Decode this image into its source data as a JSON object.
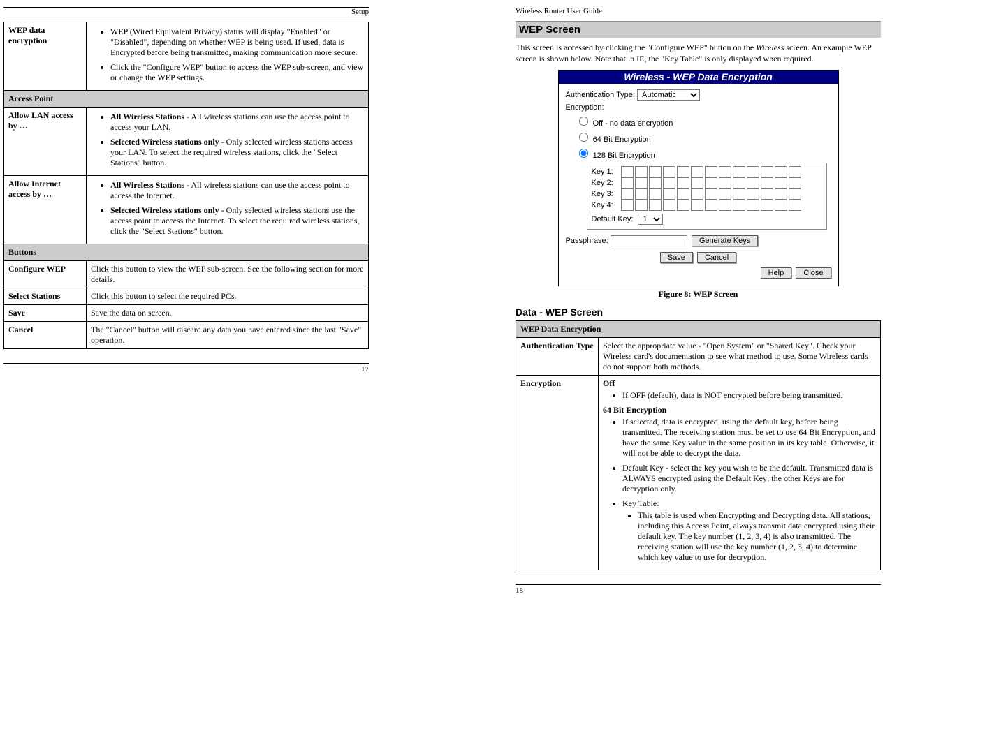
{
  "left": {
    "header": "Setup",
    "pagenum": "17",
    "row_wep_label": "WEP data encryption",
    "row_wep_b1": "WEP (Wired Equivalent Privacy) status will display \"Enabled\" or \"Disabled\", depending on whether WEP is being used. If used, data is Encrypted before being transmitted, making communication more secure.",
    "row_wep_b2": "Click the \"Configure WEP\" button to access the WEP sub-screen, and view or change the WEP settings.",
    "sec_ap": "Access Point",
    "row_lan_label": "Allow LAN access by …",
    "row_lan_b1_bold": "All Wireless Stations ",
    "row_lan_b1_rest": " - All wireless stations can use the access point to access your LAN.",
    "row_lan_b2_bold": "Selected Wireless stations only",
    "row_lan_b2_rest": " - Only selected wireless stations access your LAN. To select the required wireless stations, click the \"Select Stations\" button.",
    "row_int_label": "Allow Internet access by …",
    "row_int_b1_bold": "All Wireless Stations ",
    "row_int_b1_rest": " - All wireless stations can use the access point to access the Internet.",
    "row_int_b2_bold": "Selected Wireless stations only",
    "row_int_b2_rest": " - Only selected wireless stations use the access point to access the Internet. To select the required wireless stations, click the \"Select Stations\" button.",
    "sec_buttons": "Buttons",
    "btn_cfg_label": "Configure WEP",
    "btn_cfg_text": "Click this button to view the WEP sub-screen. See the following section for more details.",
    "btn_sel_label": "Select Stations",
    "btn_sel_text": "Click this button to select the required PCs.",
    "btn_save_label": "Save",
    "btn_save_text": "Save the data on screen.",
    "btn_cancel_label": "Cancel",
    "btn_cancel_text": "The \"Cancel\" button will discard any data you have entered since the last \"Save\" operation."
  },
  "right": {
    "header": "Wireless Router User Guide",
    "pagenum": "18",
    "title": "WEP Screen",
    "intro_1": "This screen is accessed by clicking the \"Configure WEP\" button on the ",
    "intro_em": "Wireless",
    "intro_2": " screen. An example WEP screen is shown below. Note that in IE, the \"Key Table\" is only displayed when required.",
    "figcap": "Figure 8: WEP Screen",
    "h3": "Data - WEP Screen",
    "sec_wep": "WEP Data Encryption",
    "auth_label": "Authentication Type",
    "auth_text": "Select the appropriate value - \"Open System\" or \"Shared Key\". Check your Wireless card's documentation to see what method to use. Some Wireless cards do not support both methods.",
    "enc_label": "Encryption",
    "enc_off": "Off",
    "enc_off_b1": "If OFF (default), data is NOT encrypted before being transmitted.",
    "enc_64": "64 Bit Encryption",
    "enc_64_b1": "If selected, data is encrypted, using the default key, before being transmitted. The receiving station must be set to use 64 Bit Encryption, and have the same Key value in the same position in its key table. Otherwise, it will not be able to decrypt the data.",
    "enc_64_b2": "Default Key - select the key you wish to be the default. Transmitted data is ALWAYS encrypted using the Default Key; the other Keys are for decryption only.",
    "enc_64_b3": "Key Table:",
    "enc_64_b3_s1": "This table is used when Encrypting and Decrypting data. All stations, including this Access Point, always transmit data encrypted using their default key. The key number (1, 2, 3, 4) is also transmitted. The receiving station will use the key number (1, 2, 3, 4) to determine which key value to use for decryption."
  },
  "shot": {
    "title": "Wireless - WEP Data Encryption",
    "auth_label": "Authentication Type:",
    "auth_value": "Automatic",
    "enc_label": "Encryption:",
    "opt_off": "Off - no data encryption",
    "opt_64": "64 Bit Encryption",
    "opt_128": "128 Bit Encryption",
    "key1": "Key 1:",
    "key2": "Key 2:",
    "key3": "Key 3:",
    "key4": "Key 4:",
    "defkey": "Default Key:",
    "defkey_value": "1",
    "pass_label": "Passphrase:",
    "btn_gen": "Generate Keys",
    "btn_save": "Save",
    "btn_cancel": "Cancel",
    "btn_help": "Help",
    "btn_close": "Close"
  }
}
